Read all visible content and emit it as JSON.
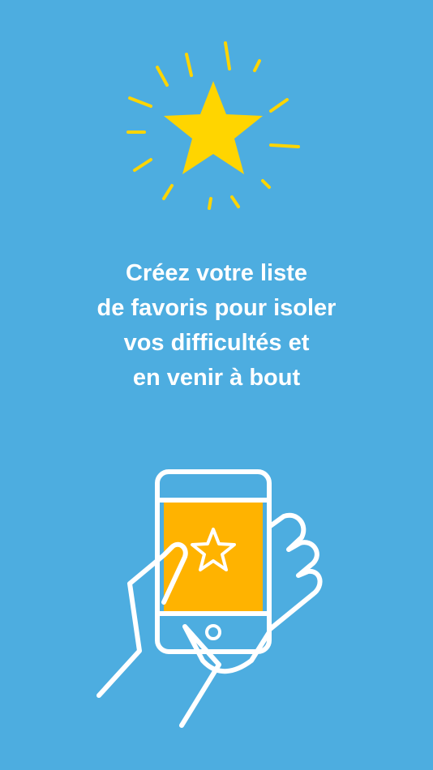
{
  "colors": {
    "background": "#4dade0",
    "star": "#ffd500",
    "rays": "#ffd500",
    "screen": "#ffb300",
    "outline": "#ffffff",
    "text": "#ffffff"
  },
  "hero": {
    "icon": "star-burst-icon"
  },
  "headline": {
    "line1": "Créez votre liste",
    "line2": "de favoris pour isoler",
    "line3": "vos difficultés et",
    "line4": "en venir à bout"
  },
  "illustration": {
    "icon": "hand-holding-phone-icon",
    "screen_icon": "star-outline-icon"
  }
}
